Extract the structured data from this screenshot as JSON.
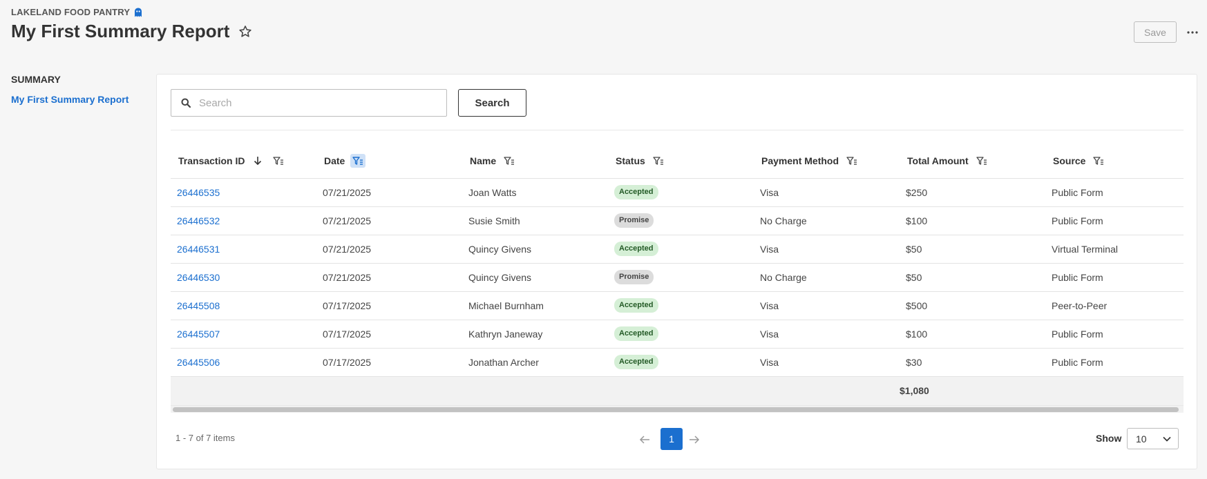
{
  "header": {
    "org_name": "LAKELAND FOOD PANTRY",
    "title": "My First Summary Report",
    "save_label": "Save"
  },
  "sidebar": {
    "heading": "SUMMARY",
    "items": [
      {
        "label": "My First Summary Report"
      }
    ]
  },
  "search": {
    "placeholder": "Search",
    "value": "",
    "button_label": "Search"
  },
  "table": {
    "columns": [
      {
        "label": "Transaction ID",
        "sorted": "descending",
        "filter_active": false
      },
      {
        "label": "Date",
        "filter_active": true
      },
      {
        "label": "Name",
        "filter_active": false
      },
      {
        "label": "Status",
        "filter_active": false
      },
      {
        "label": "Payment Method",
        "filter_active": false
      },
      {
        "label": "Total Amount",
        "filter_active": false
      },
      {
        "label": "Source",
        "filter_active": false
      }
    ],
    "rows": [
      {
        "id": "26446535",
        "date": "07/21/2025",
        "name": "Joan Watts",
        "status": "Accepted",
        "method": "Visa",
        "amount": "$250",
        "source": "Public Form"
      },
      {
        "id": "26446532",
        "date": "07/21/2025",
        "name": "Susie Smith",
        "status": "Promise",
        "method": "No Charge",
        "amount": "$100",
        "source": "Public Form"
      },
      {
        "id": "26446531",
        "date": "07/21/2025",
        "name": "Quincy Givens",
        "status": "Accepted",
        "method": "Visa",
        "amount": "$50",
        "source": "Virtual Terminal"
      },
      {
        "id": "26446530",
        "date": "07/21/2025",
        "name": "Quincy Givens",
        "status": "Promise",
        "method": "No Charge",
        "amount": "$50",
        "source": "Public Form"
      },
      {
        "id": "26445508",
        "date": "07/17/2025",
        "name": "Michael Burnham",
        "status": "Accepted",
        "method": "Visa",
        "amount": "$500",
        "source": "Peer-to-Peer"
      },
      {
        "id": "26445507",
        "date": "07/17/2025",
        "name": "Kathryn Janeway",
        "status": "Accepted",
        "method": "Visa",
        "amount": "$100",
        "source": "Public Form"
      },
      {
        "id": "26445506",
        "date": "07/17/2025",
        "name": "Jonathan Archer",
        "status": "Accepted",
        "method": "Visa",
        "amount": "$30",
        "source": "Public Form"
      }
    ],
    "total_amount": "$1,080"
  },
  "pagination": {
    "info": "1 - 7 of 7 items",
    "current_page": "1",
    "show_label": "Show",
    "page_size": "10"
  },
  "colors": {
    "link": "#1b6fcf",
    "accepted_bg": "#d5efd6",
    "promise_bg": "#dcdcdc",
    "active_filter_bg": "#cfe1f7"
  }
}
